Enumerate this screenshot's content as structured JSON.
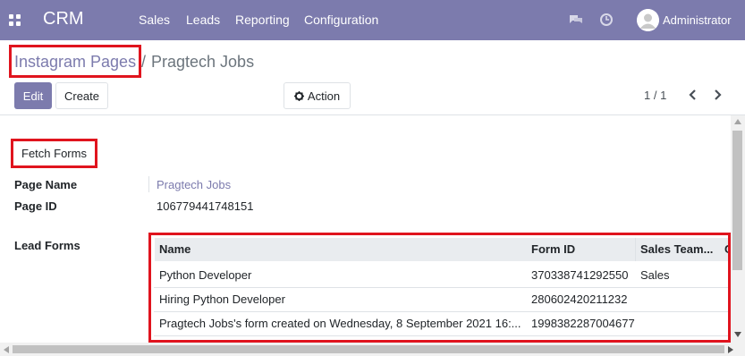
{
  "navbar": {
    "brand": "CRM",
    "menu": [
      "Sales",
      "Leads",
      "Reporting",
      "Configuration"
    ],
    "user": "Administrator",
    "icons": [
      "apps-icon",
      "chat-icon",
      "clock-icon",
      "avatar"
    ]
  },
  "breadcrumb": {
    "parent": "Instagram Pages",
    "separator": "/",
    "current": "Pragtech Jobs"
  },
  "buttons": {
    "edit": "Edit",
    "create": "Create",
    "action": "Action"
  },
  "pager": {
    "value": "1 / 1"
  },
  "form": {
    "fetch_button": "Fetch Forms",
    "page_name_label": "Page Name",
    "page_name_value": "Pragtech Jobs",
    "page_id_label": "Page ID",
    "page_id_value": "106779441748151",
    "lead_forms_label": "Lead Forms"
  },
  "lead_forms": {
    "columns": [
      "Name",
      "Form ID",
      "Sales Team...",
      "C"
    ],
    "rows": [
      [
        "Python Developer",
        "370338741292550",
        "Sales"
      ],
      [
        "Hiring Python Developer",
        "280602420211232",
        ""
      ],
      [
        "Pragtech Jobs's form created on Wednesday, 8 September 2021 16:...",
        "1998382287004677",
        ""
      ]
    ]
  },
  "colors": {
    "navbar": "#7c7bad",
    "link": "#7c7bad",
    "highlight": "#e0141e"
  }
}
